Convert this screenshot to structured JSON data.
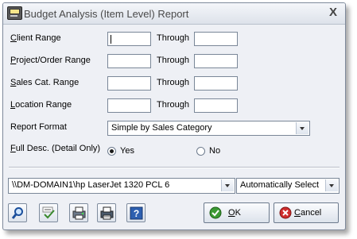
{
  "window": {
    "title": "Budget Analysis (Item Level) Report",
    "close": "X"
  },
  "rows": [
    {
      "label": "Client Range",
      "underline": "C",
      "rest": "lient Range",
      "from": "",
      "to": ""
    },
    {
      "label": "Project/Order Range",
      "underline": "P",
      "rest": "roject/Order Range",
      "from": "",
      "to": ""
    },
    {
      "label": "Sales Cat. Range",
      "underline": "S",
      "rest": "ales Cat. Range",
      "from": "",
      "to": ""
    },
    {
      "label": "Location Range",
      "underline": "L",
      "rest": "ocation Range",
      "from": "",
      "to": ""
    }
  ],
  "through_label": "Through",
  "report_format": {
    "label": "Report Format",
    "value": "Simple by Sales Category"
  },
  "full_desc": {
    "label": "Full Desc. (Detail Only)",
    "underline": "F",
    "rest": "ull Desc. (Detail Only)",
    "options": [
      {
        "label": "Yes",
        "selected": true
      },
      {
        "label": "No",
        "selected": false
      }
    ]
  },
  "printer": {
    "value": "\\\\DM-DOMAIN1\\hp LaserJet 1320 PCL 6"
  },
  "tray": {
    "value": "Automatically Select"
  },
  "buttons": {
    "ok": {
      "underline": "O",
      "rest": "K"
    },
    "cancel": {
      "underline": "C",
      "rest": "ancel"
    }
  },
  "toolbar_icons": [
    "preview-icon",
    "spell-check-icon",
    "print-setup-icon",
    "printer-icon",
    "help-icon"
  ]
}
